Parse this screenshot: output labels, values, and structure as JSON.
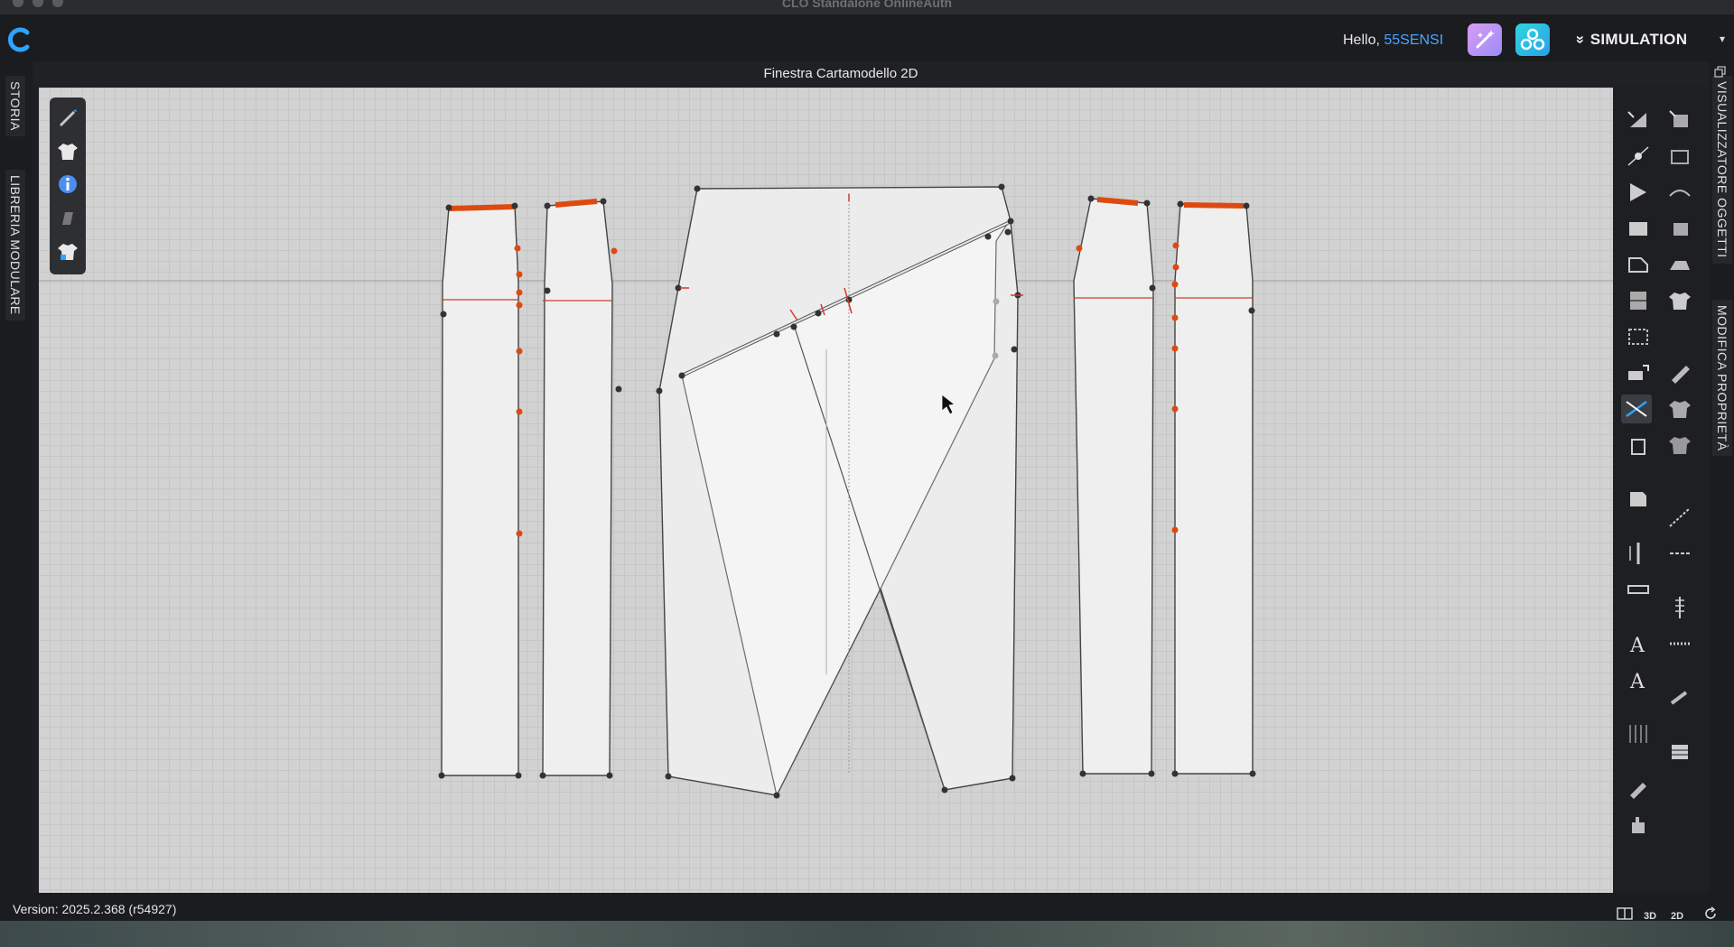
{
  "window": {
    "title": "CLO Standalone OnlineAuth"
  },
  "topbar": {
    "greeting": "Hello,",
    "username": "55SENSI",
    "mode_label": "SIMULATION",
    "mode_caret": "▾",
    "mode_chevron": "»"
  },
  "left_tabs": {
    "history": "STORIA",
    "modular_library": "LIBRERIA MODULARE"
  },
  "right_tabs": {
    "object_browser": "VISUALIZZATORE OGGETTI",
    "property_editor": "MODIFICA PROPRIETÀ"
  },
  "panel": {
    "title": "Finestra Cartamodello 2D"
  },
  "footer": {
    "version": "Version: 2025.2.368 (r54927)",
    "view_3d": "3D",
    "view_2d": "2D"
  },
  "icons": {
    "left_tools": [
      "pen-icon",
      "garment-icon",
      "info-icon",
      "eraser-icon",
      "avatar-garment-icon"
    ],
    "right_tools": [
      "edit-pattern-icon",
      "transform-icon",
      "edit-point-icon",
      "polygon-icon",
      "rectangle-icon",
      "internal-polygon-icon",
      "fold-icon",
      "zoom-select-icon",
      "pattern-tool-icon",
      "sewing-line-icon",
      "segment-sewing-icon",
      "notch-icon",
      "ruler-icon",
      "measure-icon",
      "text-icon",
      "text-edit-icon",
      "grid-icon",
      "button-icon",
      "pin-icon"
    ],
    "accent": "#2ea3ff",
    "seam_color": "#dd4a10"
  }
}
